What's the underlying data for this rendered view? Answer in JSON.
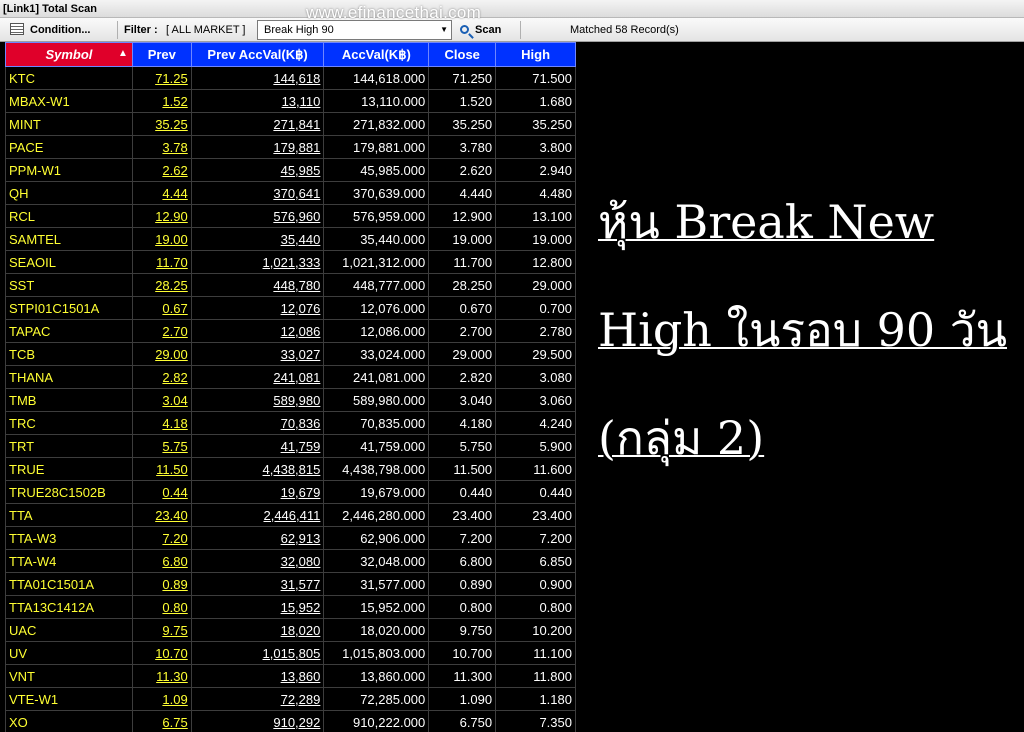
{
  "window": {
    "title": "[Link1] Total Scan"
  },
  "watermark": "www.efinancethai.com",
  "toolbar": {
    "condition_label": "Condition...",
    "filter_label": "Filter :",
    "filter_value": "[ ALL MARKET ]",
    "scan_selected": "Break High 90",
    "scan_label": "Scan",
    "matched_text": "Matched 58 Record(s)"
  },
  "table": {
    "headers": [
      "Symbol",
      "Prev",
      "Prev AccVal(K฿)",
      "AccVal(K฿)",
      "Close",
      "High"
    ],
    "rows": [
      [
        "KTC",
        "71.25",
        "144,618",
        "144,618.000",
        "71.250",
        "71.500"
      ],
      [
        "MBAX-W1",
        "1.52",
        "13,110",
        "13,110.000",
        "1.520",
        "1.680"
      ],
      [
        "MINT",
        "35.25",
        "271,841",
        "271,832.000",
        "35.250",
        "35.250"
      ],
      [
        "PACE",
        "3.78",
        "179,881",
        "179,881.000",
        "3.780",
        "3.800"
      ],
      [
        "PPM-W1",
        "2.62",
        "45,985",
        "45,985.000",
        "2.620",
        "2.940"
      ],
      [
        "QH",
        "4.44",
        "370,641",
        "370,639.000",
        "4.440",
        "4.480"
      ],
      [
        "RCL",
        "12.90",
        "576,960",
        "576,959.000",
        "12.900",
        "13.100"
      ],
      [
        "SAMTEL",
        "19.00",
        "35,440",
        "35,440.000",
        "19.000",
        "19.000"
      ],
      [
        "SEAOIL",
        "11.70",
        "1,021,333",
        "1,021,312.000",
        "11.700",
        "12.800"
      ],
      [
        "SST",
        "28.25",
        "448,780",
        "448,777.000",
        "28.250",
        "29.000"
      ],
      [
        "STPI01C1501A",
        "0.67",
        "12,076",
        "12,076.000",
        "0.670",
        "0.700"
      ],
      [
        "TAPAC",
        "2.70",
        "12,086",
        "12,086.000",
        "2.700",
        "2.780"
      ],
      [
        "TCB",
        "29.00",
        "33,027",
        "33,024.000",
        "29.000",
        "29.500"
      ],
      [
        "THANA",
        "2.82",
        "241,081",
        "241,081.000",
        "2.820",
        "3.080"
      ],
      [
        "TMB",
        "3.04",
        "589,980",
        "589,980.000",
        "3.040",
        "3.060"
      ],
      [
        "TRC",
        "4.18",
        "70,836",
        "70,835.000",
        "4.180",
        "4.240"
      ],
      [
        "TRT",
        "5.75",
        "41,759",
        "41,759.000",
        "5.750",
        "5.900"
      ],
      [
        "TRUE",
        "11.50",
        "4,438,815",
        "4,438,798.000",
        "11.500",
        "11.600"
      ],
      [
        "TRUE28C1502B",
        "0.44",
        "19,679",
        "19,679.000",
        "0.440",
        "0.440"
      ],
      [
        "TTA",
        "23.40",
        "2,446,411",
        "2,446,280.000",
        "23.400",
        "23.400"
      ],
      [
        "TTA-W3",
        "7.20",
        "62,913",
        "62,906.000",
        "7.200",
        "7.200"
      ],
      [
        "TTA-W4",
        "6.80",
        "32,080",
        "32,048.000",
        "6.800",
        "6.850"
      ],
      [
        "TTA01C1501A",
        "0.89",
        "31,577",
        "31,577.000",
        "0.890",
        "0.900"
      ],
      [
        "TTA13C1412A",
        "0.80",
        "15,952",
        "15,952.000",
        "0.800",
        "0.800"
      ],
      [
        "UAC",
        "9.75",
        "18,020",
        "18,020.000",
        "9.750",
        "10.200"
      ],
      [
        "UV",
        "10.70",
        "1,015,805",
        "1,015,803.000",
        "10.700",
        "11.100"
      ],
      [
        "VNT",
        "11.30",
        "13,860",
        "13,860.000",
        "11.300",
        "11.800"
      ],
      [
        "VTE-W1",
        "1.09",
        "72,289",
        "72,285.000",
        "1.090",
        "1.180"
      ],
      [
        "XO",
        "6.75",
        "910,292",
        "910,222.000",
        "6.750",
        "7.350"
      ]
    ]
  },
  "annotation": {
    "lines": [
      "หุ้น Break New",
      "High ในรอบ 90 วัน",
      "(กลุ่ม 2)"
    ]
  },
  "colors": {
    "header_blue": "#0032ff",
    "symbol_header_red": "#e0002a",
    "symbol_text": "#ffff33",
    "background": "#000000"
  }
}
